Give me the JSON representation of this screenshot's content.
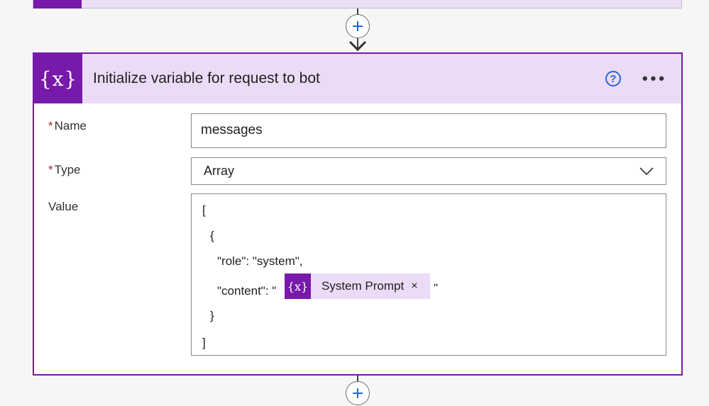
{
  "card": {
    "icon": "{x}",
    "title": "Initialize variable for request to bot",
    "help": "?",
    "more": "•••"
  },
  "fields": {
    "required_mark": "*",
    "name_label": "Name",
    "name_value": "messages",
    "type_label": "Type",
    "type_value": "Array",
    "value_label": "Value"
  },
  "value_lines": [
    "[",
    "{",
    "\"role\": \"system\",",
    "\"content\": \"",
    "}",
    "]"
  ],
  "token": {
    "icon": "{x}",
    "label": "System Prompt",
    "close": "×",
    "trailing": "\""
  },
  "icons": [
    "plus-icon",
    "chevron-down-icon",
    "help-icon",
    "more-icon",
    "variable-icon",
    "close-icon",
    "arrow-down-icon"
  ],
  "colors": {
    "accent": "#7719aa",
    "header_bg": "#ebdbf6",
    "help_blue": "#2266e3"
  }
}
